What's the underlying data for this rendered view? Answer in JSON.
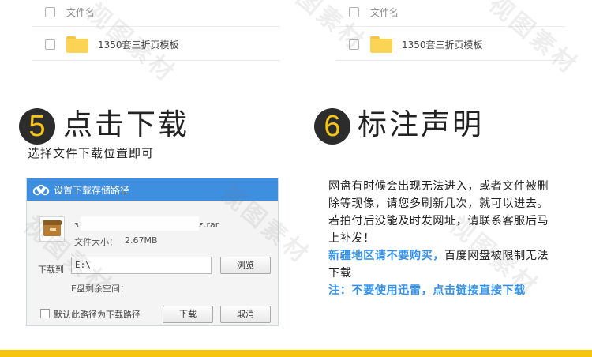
{
  "top_panels": {
    "left": {
      "header": "文件名",
      "file_name": "1350套三折页模板"
    },
    "right": {
      "header": "文件名",
      "file_name": "1350套三折页模板"
    }
  },
  "section5": {
    "number": "5",
    "title": "点击下载",
    "subtitle": "选择文件下载位置即可"
  },
  "dialog": {
    "title": "设置下载存储路径",
    "file_name_prefix": "з",
    "file_name_suffix": "ε.rar",
    "file_size_label": "文件大小：",
    "file_size_value": "2.67MB",
    "save_to_label": "下载到",
    "save_path": "E:\\",
    "browse_label": "浏览",
    "space_label": "E盘剩余空间：",
    "default_path_label": "默认此路径为下载路径",
    "download_label": "下载",
    "cancel_label": "取消"
  },
  "section6": {
    "number": "6",
    "title": "标注声明"
  },
  "notice": {
    "para1": "网盘有时候会出现无法进入，或者文件被删除等现像，请您多刷新几次，就可以进去。若拍付后没能及时发网址，请联系客服后马上补发！",
    "para2_blue": "新疆地区请不要购买，",
    "para2_rest": "百度网盘被限制无法下载",
    "para3_blue": "注：不要使用迅雷，点击链接直接下载"
  },
  "watermark": "视图素材",
  "colors": {
    "accent_yellow": "#f5c40b",
    "circle_bg": "#2c2c2c",
    "dialog_titlebar": "#3f8fe0",
    "notice_blue": "#3592e8"
  }
}
